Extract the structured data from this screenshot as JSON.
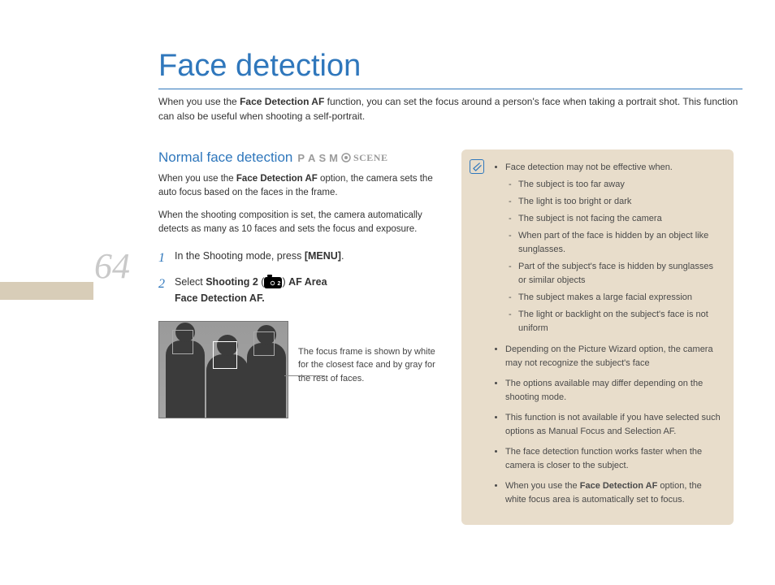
{
  "page_number": "64",
  "title": "Face detection",
  "intro_a": "When you use the ",
  "intro_bold": "Face Detection AF",
  "intro_b": " function, you can set the focus around a person's face when taking a portrait shot. This function can also be useful when shooting a self-portrait.",
  "section": {
    "heading": "Normal face detection",
    "modes": {
      "p": "P",
      "a": "A",
      "s": "S",
      "m": "M",
      "scene": "SCENE"
    },
    "p1a": "When you use the ",
    "p1bold": "Face Detection AF",
    "p1b": " option, the camera sets the auto focus based on the faces in the frame.",
    "p2": "When the shooting composition is set, the camera automatically detects as many as 10 faces and sets the focus and exposure."
  },
  "steps": {
    "s1": {
      "num": "1",
      "a": "In the Shooting mode, press ",
      "b": "[MENU]",
      "c": "."
    },
    "s2": {
      "num": "2",
      "a": "Select ",
      "b": "Shooting 2",
      "c": " (",
      "icon_sub": "2",
      "d": ")  ",
      "e": "AF Area",
      "f": "Face Detection AF."
    }
  },
  "caption": "The focus frame is shown by white for the closest face and by gray for the rest of faces.",
  "notes": {
    "lead": "Face detection may not be effective when.",
    "sub": [
      "The subject is too far away",
      "The light is too bright or dark",
      "The subject is not facing the camera",
      "When part of the face is hidden by an object like sunglasses.",
      "Part of the subject's face is hidden by sunglasses or similar objects",
      "The subject makes a large facial expression",
      "The light or backlight on the subject's face is not uniform"
    ],
    "b2": "Depending on the Picture Wizard option, the camera may not recognize the subject's face",
    "b3": "The options available may differ depending on the shooting mode.",
    "b4": "This function is not available if you have selected such options as Manual Focus and Selection AF.",
    "b5": "The face detection function works faster when the camera is closer to the subject.",
    "b6a": "When you use the ",
    "b6bold": "Face Detection AF",
    "b6b": " option, the white focus area is automatically set to focus."
  }
}
